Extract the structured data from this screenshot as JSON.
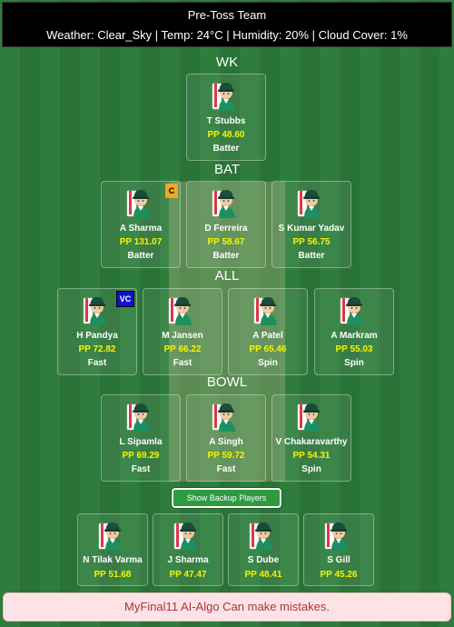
{
  "header": {
    "title": "Pre-Toss Team",
    "weather": "Weather: Clear_Sky | Temp: 24°C | Humidity: 20% | Cloud Cover: 1%"
  },
  "sections": {
    "wk": "WK",
    "bat": "BAT",
    "all": "ALL",
    "bowl": "BOWL"
  },
  "players": {
    "wk": [
      {
        "name": "T Stubbs",
        "pp": "PP 48.60",
        "role": "Batter"
      }
    ],
    "bat": [
      {
        "name": "A Sharma",
        "pp": "PP 131.07",
        "role": "Batter",
        "badge": "C"
      },
      {
        "name": "D Ferreira",
        "pp": "PP 58.67",
        "role": "Batter"
      },
      {
        "name": "S Kumar Yadav",
        "pp": "PP 56.75",
        "role": "Batter"
      }
    ],
    "all": [
      {
        "name": "H Pandya",
        "pp": "PP 72.82",
        "role": "Fast",
        "badge": "VC"
      },
      {
        "name": "M Jansen",
        "pp": "PP 66.22",
        "role": "Fast"
      },
      {
        "name": "A Patel",
        "pp": "PP 65.46",
        "role": "Spin"
      },
      {
        "name": "A Markram",
        "pp": "PP 55.03",
        "role": "Spin"
      }
    ],
    "bowl": [
      {
        "name": "L Sipamla",
        "pp": "PP 69.29",
        "role": "Fast"
      },
      {
        "name": "A Singh",
        "pp": "PP 59.72",
        "role": "Fast"
      },
      {
        "name": "V Chakaravarthy",
        "pp": "PP 54.31",
        "role": "Spin"
      }
    ],
    "backup": [
      {
        "name": "N Tilak Varma",
        "pp": "PP 51.68"
      },
      {
        "name": "J Sharma",
        "pp": "PP 47.47"
      },
      {
        "name": "S Dube",
        "pp": "PP 48.41"
      },
      {
        "name": "S Gill",
        "pp": "PP 45.26"
      }
    ]
  },
  "backup_button": "Show Backup Players",
  "footer": "MyFinal11 AI-Algo Can make mistakes.",
  "colors": {
    "points": "#f5f500",
    "captain_badge": "#f5a623",
    "vice_captain_badge": "#1010d0",
    "button": "#2f9b3f"
  },
  "icons": {
    "player": "cricketer-avatar-icon"
  }
}
